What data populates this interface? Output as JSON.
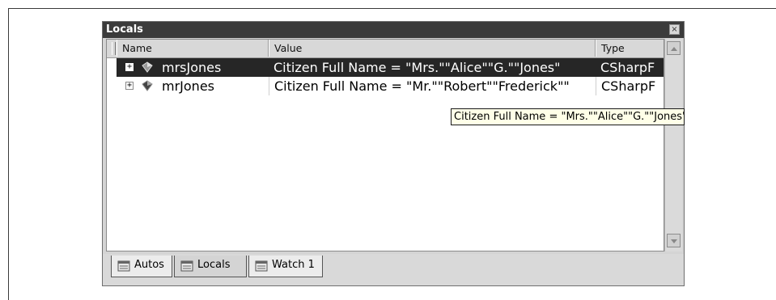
{
  "panel": {
    "title": "Locals",
    "close_glyph": "×"
  },
  "columns": [
    {
      "label": "Name"
    },
    {
      "label": "Value"
    },
    {
      "label": "Type"
    }
  ],
  "rows": [
    {
      "expander": "+",
      "icon": "object-icon",
      "name": "mrsJones",
      "value": "Citizen Full Name = \"Mrs.\"\"Alice\"\"G.\"\"Jones\"",
      "type": "CSharpF",
      "selected": true
    },
    {
      "expander": "+",
      "icon": "object-icon",
      "name": "mrJones",
      "value": "Citizen Full Name = \"Mr.\"\"Robert\"\"Frederick\"\"",
      "type": "CSharpF",
      "selected": false
    }
  ],
  "tooltip": "Citizen Full Name = \"Mrs.\"\"Alice\"\"G.\"\"Jones\"",
  "tabs": [
    {
      "label": "Autos",
      "icon": "autos-window-icon"
    },
    {
      "label": "Locals",
      "icon": "locals-window-icon",
      "active": true
    },
    {
      "label": "Watch 1",
      "icon": "watch-window-icon"
    }
  ],
  "colors": {
    "titlebar": "#3b3b3b",
    "selection": "#262626",
    "tooltip_bg": "#ffffe8",
    "window_bg": "#d4d4d4"
  }
}
